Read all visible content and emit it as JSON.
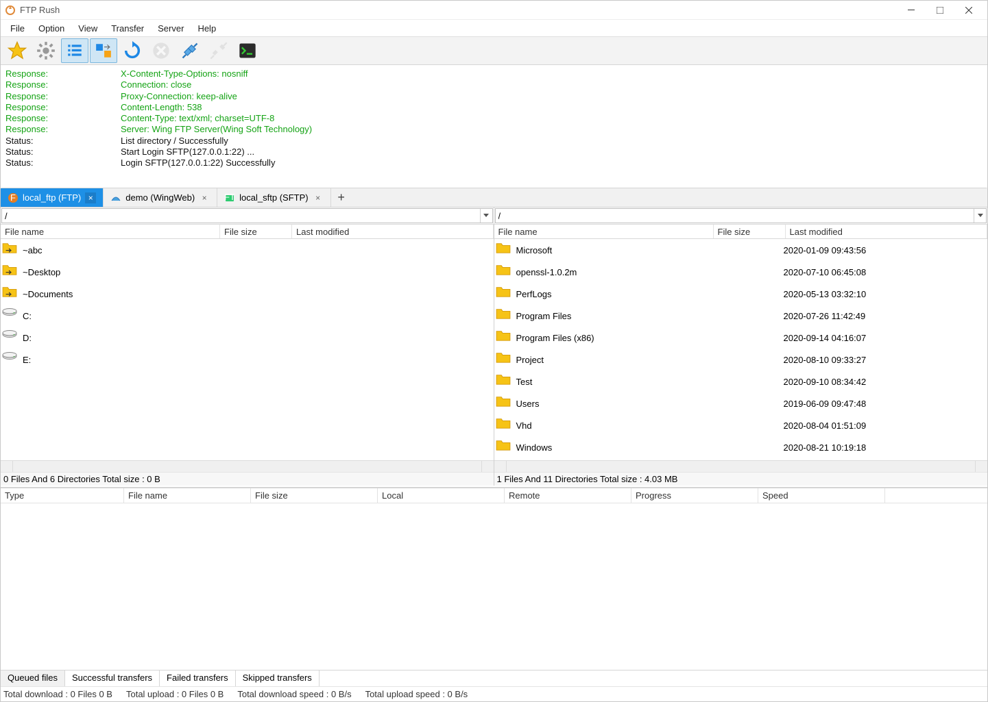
{
  "window": {
    "title": "FTP Rush"
  },
  "menu": {
    "items": [
      "File",
      "Option",
      "View",
      "Transfer",
      "Server",
      "Help"
    ]
  },
  "toolbar": {
    "buttons": [
      {
        "name": "favorite-icon",
        "active": false
      },
      {
        "name": "settings-icon",
        "active": false
      },
      {
        "name": "list-view-icon",
        "active": true
      },
      {
        "name": "compare-icon",
        "active": true
      },
      {
        "name": "refresh-icon",
        "active": false
      },
      {
        "name": "stop-icon",
        "active": false,
        "disabled": true
      },
      {
        "name": "connect-icon",
        "active": false
      },
      {
        "name": "disconnect-icon",
        "active": false,
        "disabled": true
      },
      {
        "name": "terminal-icon",
        "active": false
      }
    ]
  },
  "log": [
    {
      "k": "Response:",
      "v": "X-Content-Type-Options: nosniff",
      "c": "green"
    },
    {
      "k": "Response:",
      "v": "Connection: close",
      "c": "green"
    },
    {
      "k": "Response:",
      "v": "Proxy-Connection: keep-alive",
      "c": "green"
    },
    {
      "k": "Response:",
      "v": "Content-Length: 538",
      "c": "green"
    },
    {
      "k": "Response:",
      "v": "Content-Type: text/xml; charset=UTF-8",
      "c": "green"
    },
    {
      "k": "Response:",
      "v": "Server: Wing FTP Server(Wing Soft Technology)",
      "c": "green"
    },
    {
      "k": "Status:",
      "v": "List directory / Successfully",
      "c": "black"
    },
    {
      "k": "Status:",
      "v": "Start Login SFTP(127.0.0.1:22) ...",
      "c": "black"
    },
    {
      "k": "Status:",
      "v": "Login SFTP(127.0.0.1:22) Successfully",
      "c": "black"
    }
  ],
  "tabs": [
    {
      "label": "local_ftp (FTP)",
      "icon": "ftp",
      "active": true,
      "closable": true
    },
    {
      "label": "demo (WingWeb)",
      "icon": "web",
      "active": false,
      "closable": true
    },
    {
      "label": "local_sftp (SFTP)",
      "icon": "sftp",
      "active": false,
      "closable": true
    }
  ],
  "left": {
    "path": "/",
    "columns": {
      "name": "File name",
      "size": "File size",
      "modified": "Last modified"
    },
    "rows": [
      {
        "name": "~abc",
        "type": "linkfolder",
        "size": "",
        "modified": ""
      },
      {
        "name": "~Desktop",
        "type": "linkfolder",
        "size": "",
        "modified": ""
      },
      {
        "name": "~Documents",
        "type": "linkfolder",
        "size": "",
        "modified": ""
      },
      {
        "name": "C:",
        "type": "drive",
        "size": "",
        "modified": ""
      },
      {
        "name": "D:",
        "type": "drive",
        "size": "",
        "modified": ""
      },
      {
        "name": "E:",
        "type": "drive",
        "size": "",
        "modified": ""
      }
    ],
    "status": "0 Files And 6 Directories Total size : 0 B"
  },
  "right": {
    "path": "/",
    "columns": {
      "name": "File name",
      "size": "File size",
      "modified": "Last modified"
    },
    "rows": [
      {
        "name": "Microsoft",
        "type": "folder",
        "size": "",
        "modified": "2020-01-09 09:43:56"
      },
      {
        "name": "openssl-1.0.2m",
        "type": "folder",
        "size": "",
        "modified": "2020-07-10 06:45:08"
      },
      {
        "name": "PerfLogs",
        "type": "folder",
        "size": "",
        "modified": "2020-05-13 03:32:10"
      },
      {
        "name": "Program Files",
        "type": "folder",
        "size": "",
        "modified": "2020-07-26 11:42:49"
      },
      {
        "name": "Program Files (x86)",
        "type": "folder",
        "size": "",
        "modified": "2020-09-14 04:16:07"
      },
      {
        "name": "Project",
        "type": "folder",
        "size": "",
        "modified": "2020-08-10 09:33:27"
      },
      {
        "name": "Test",
        "type": "folder",
        "size": "",
        "modified": "2020-09-10 08:34:42"
      },
      {
        "name": "Users",
        "type": "folder",
        "size": "",
        "modified": "2019-06-09 09:47:48"
      },
      {
        "name": "Vhd",
        "type": "folder",
        "size": "",
        "modified": "2020-08-04 01:51:09"
      },
      {
        "name": "Windows",
        "type": "folder",
        "size": "",
        "modified": "2020-08-21 10:19:18"
      }
    ],
    "status": "1 Files And 11 Directories Total size : 4.03 MB"
  },
  "queue": {
    "columns": [
      "Type",
      "File name",
      "File size",
      "Local",
      "Remote",
      "Progress",
      "Speed"
    ],
    "tabs": [
      "Queued files",
      "Successful transfers",
      "Failed transfers",
      "Skipped transfers"
    ],
    "active_tab": 0
  },
  "status": {
    "download": "Total download : 0 Files  0 B",
    "upload": "Total upload : 0 Files  0 B",
    "dspeed": "Total download speed : 0 B/s",
    "uspeed": "Total upload speed : 0 B/s"
  }
}
